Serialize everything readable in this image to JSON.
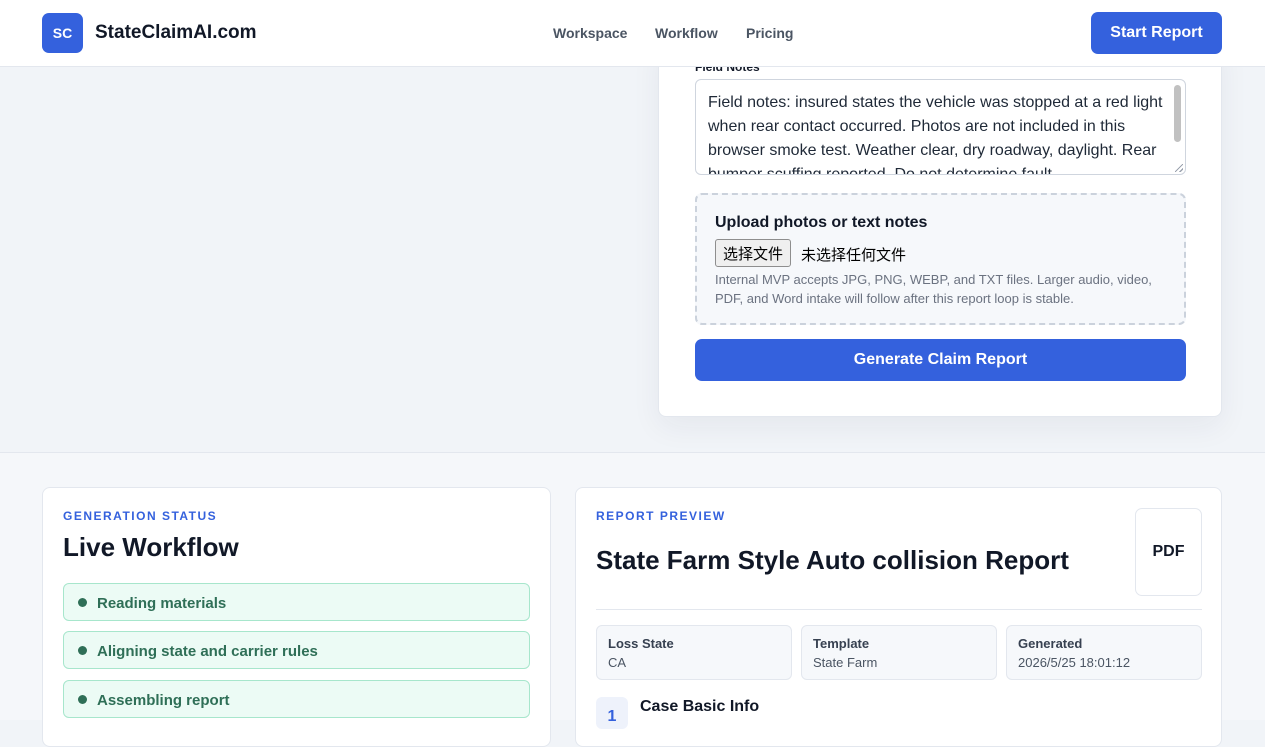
{
  "header": {
    "logo_text": "SC",
    "brand": "StateClaimAI.com",
    "nav": [
      "Workspace",
      "Workflow",
      "Pricing"
    ],
    "cta": "Start Report"
  },
  "intake": {
    "notes_label": "Field Notes",
    "notes_value": "Field notes: insured states the vehicle was stopped at a red light when rear contact occurred. Photos are not included in this browser smoke test. Weather clear, dry roadway, daylight. Rear bumper scuffing reported. Do not determine fault.",
    "upload_title": "Upload photos or text notes",
    "file_button": "选择文件",
    "file_status": "未选择任何文件",
    "upload_help": "Internal MVP accepts JPG, PNG, WEBP, and TXT files. Larger audio, video, PDF, and Word intake will follow after this report loop is stable.",
    "generate_button": "Generate Claim Report"
  },
  "status": {
    "eyebrow": "GENERATION STATUS",
    "title": "Live Workflow",
    "steps": [
      "Reading materials",
      "Aligning state and carrier rules",
      "Assembling report"
    ]
  },
  "report": {
    "eyebrow": "REPORT PREVIEW",
    "title": "State Farm Style Auto collision Report",
    "pdf_button": "PDF",
    "meta": [
      {
        "label": "Loss State",
        "value": "CA"
      },
      {
        "label": "Template",
        "value": "State Farm"
      },
      {
        "label": "Generated",
        "value": "2026/5/25 18:01:12"
      }
    ],
    "section": {
      "number": "1",
      "title": "Case Basic Info"
    }
  },
  "colors": {
    "accent": "#3461dd",
    "success_bg": "#ecfbf5",
    "success_text": "#2f6f57"
  }
}
